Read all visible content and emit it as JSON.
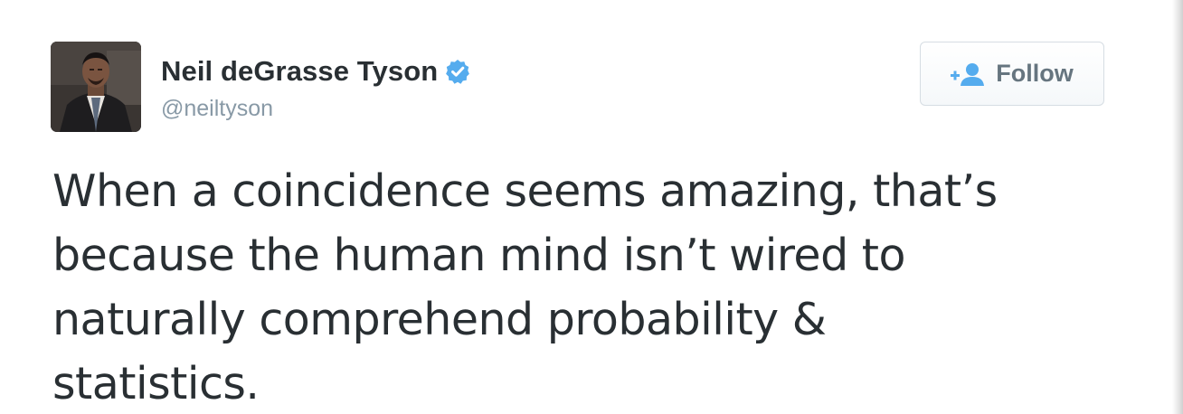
{
  "tweet": {
    "author": {
      "display_name": "Neil deGrasse Tyson",
      "username": "@neiltyson",
      "verified": true,
      "avatar_icon": "author-avatar-photo",
      "verified_icon": "verified-badge-icon"
    },
    "follow_button": {
      "label": "Follow",
      "icon": "add-user-icon"
    },
    "text_lines": [
      "When a coincidence seems amazing, that’s",
      "because the human mind isn’t wired to",
      "naturally comprehend probability &",
      "statistics."
    ]
  },
  "colors": {
    "text_primary": "#292f33",
    "text_secondary": "#8899a6",
    "verified_blue": "#55acee",
    "follow_blue": "#55acee",
    "follow_text": "#66757f",
    "button_border": "#d6dde3"
  }
}
